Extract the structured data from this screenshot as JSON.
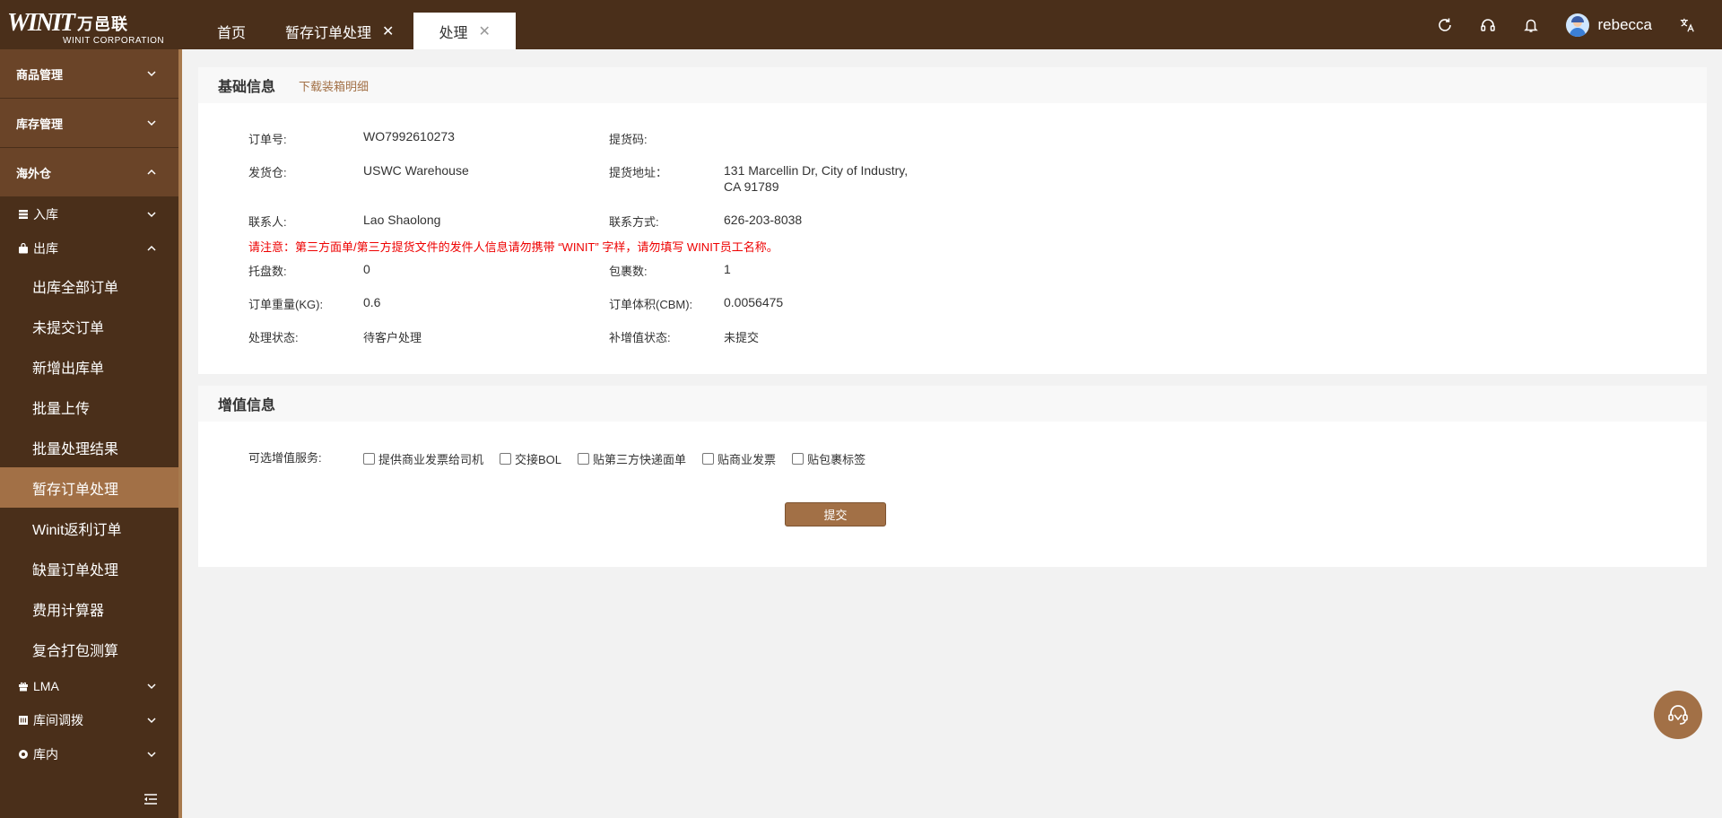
{
  "logo": {
    "brand": "WINIT",
    "brand_cn": "万邑联",
    "corp": "WINIT CORPORATION"
  },
  "tabs": [
    {
      "label": "首页",
      "closable": false,
      "active": false
    },
    {
      "label": "暂存订单处理",
      "closable": true,
      "active": false
    },
    {
      "label": "处理",
      "closable": true,
      "active": true
    }
  ],
  "header": {
    "username": "rebecca",
    "icons": [
      "refresh-icon",
      "headset-icon",
      "bell-icon",
      "avatar",
      "translate-icon"
    ]
  },
  "sidebar": {
    "groups": [
      {
        "label": "商品管理",
        "open": false
      },
      {
        "label": "库存管理",
        "open": false
      },
      {
        "label": "海外仓",
        "open": true
      }
    ],
    "overseas": {
      "inbound": "入库",
      "outbound": "出库",
      "outbound_items": [
        "出库全部订单",
        "未提交订单",
        "新增出库单",
        "批量上传",
        "批量处理结果",
        "暂存订单处理",
        "Winit返利订单",
        "缺量订单处理",
        "费用计算器",
        "复合打包测算"
      ],
      "active_item": "暂存订单处理",
      "lma": "LMA",
      "transfer": "库间调拨",
      "inner": "库内"
    }
  },
  "basic": {
    "title": "基础信息",
    "download_link": "下载装箱明细",
    "order_no_label": "订单号:",
    "order_no": "WO7992610273",
    "pickup_code_label": "提货码:",
    "pickup_code": "",
    "warehouse_label": "发货仓:",
    "warehouse": "USWC Warehouse",
    "pickup_addr_label": "提货地址：",
    "pickup_addr_line1": "131 Marcellin Dr, City of Industry,",
    "pickup_addr_line2": "CA 91789",
    "contact_label": "联系人:",
    "contact": "Lao Shaolong",
    "phone_label": "联系方式:",
    "phone": "626-203-8038",
    "notice": "请注意：第三方面单/第三方提货文件的发件人信息请勿携带 “WINIT” 字样，请勿填写 WINIT员工名称。",
    "pallets_label": "托盘数:",
    "pallets": "0",
    "parcels_label": "包裹数:",
    "parcels": "1",
    "weight_label": "订单重量(KG):",
    "weight": "0.6",
    "volume_label": "订单体积(CBM):",
    "volume": "0.0056475",
    "status_label": "处理状态:",
    "status": "待客户处理",
    "vas_status_label": "补增值状态:",
    "vas_status": "未提交"
  },
  "vas": {
    "title": "增值信息",
    "options_label": "可选增值服务:",
    "options": [
      "提供商业发票给司机",
      "交接BOL",
      "贴第三方快递面单",
      "贴商业发票",
      "贴包裹标签"
    ],
    "submit": "提交"
  }
}
